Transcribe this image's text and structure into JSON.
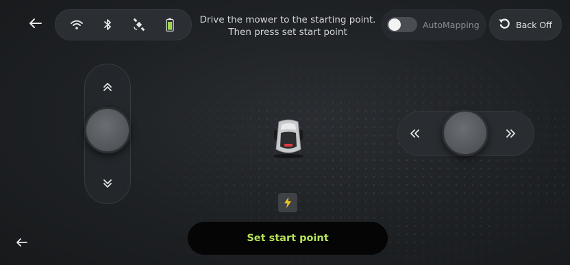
{
  "instruction": {
    "line1": "Drive the mower to the starting point.",
    "line2": "Then press set start point"
  },
  "status_icons": [
    "wifi-icon",
    "bluetooth-icon",
    "satellite-icon",
    "battery-icon"
  ],
  "auto_mapping": {
    "label": "AutoMapping",
    "enabled": false
  },
  "back_off": {
    "label": "Back Off",
    "icon": "undo-icon"
  },
  "joystick_vertical": {
    "up_icon": "double-chevron-up-icon",
    "down_icon": "double-chevron-down-icon"
  },
  "joystick_horizontal": {
    "left_icon": "double-chevron-left-icon",
    "right_icon": "double-chevron-right-icon"
  },
  "primary_action": {
    "label": "Set start point"
  },
  "colors": {
    "accent": "#b5e35a",
    "battery": "#9ed44a",
    "background": "#1e2124"
  }
}
